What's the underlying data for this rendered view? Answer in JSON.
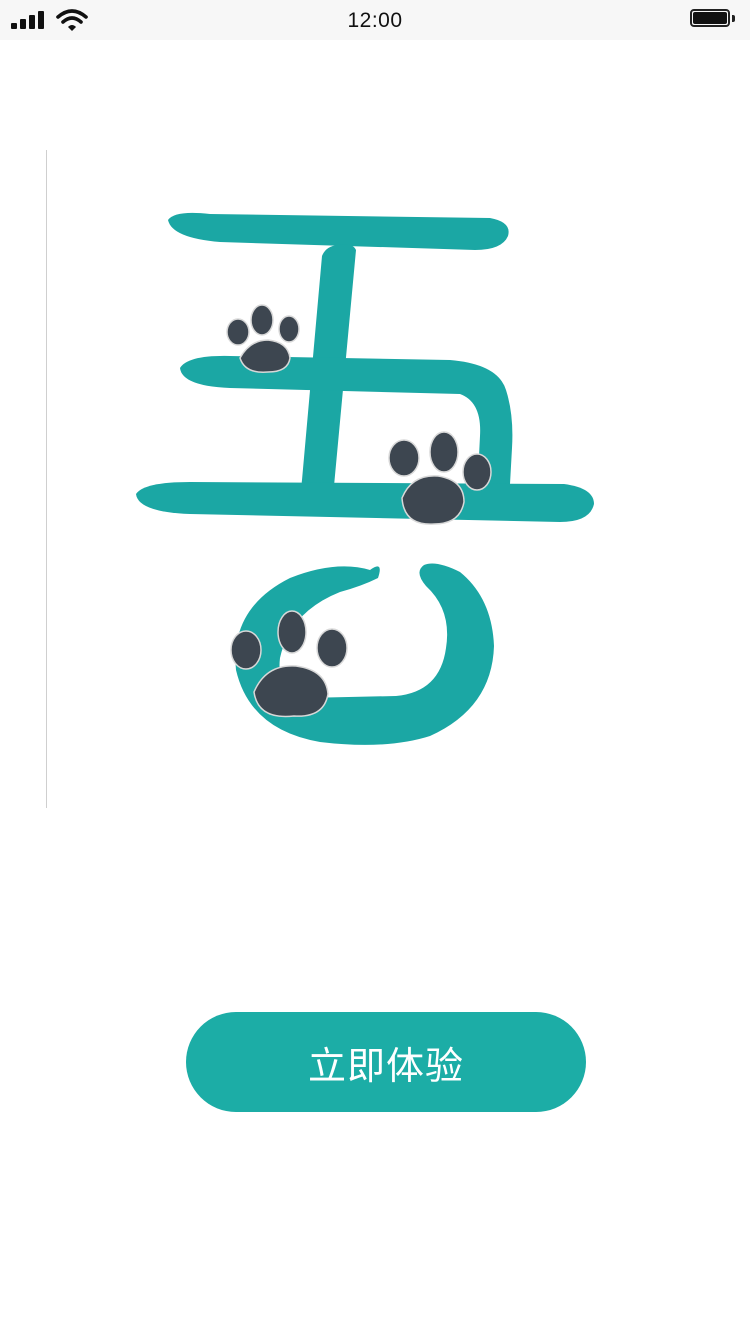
{
  "status_bar": {
    "time": "12:00",
    "signal_icon": "signal-icon",
    "wifi_icon": "wifi-icon",
    "battery_icon": "battery-icon"
  },
  "logo": {
    "icon": "paw-print-logo",
    "brand_color": "#1ba7a4",
    "paw_color": "#3d4650"
  },
  "cta": {
    "label": "立即体验",
    "color": "#1cada6"
  }
}
